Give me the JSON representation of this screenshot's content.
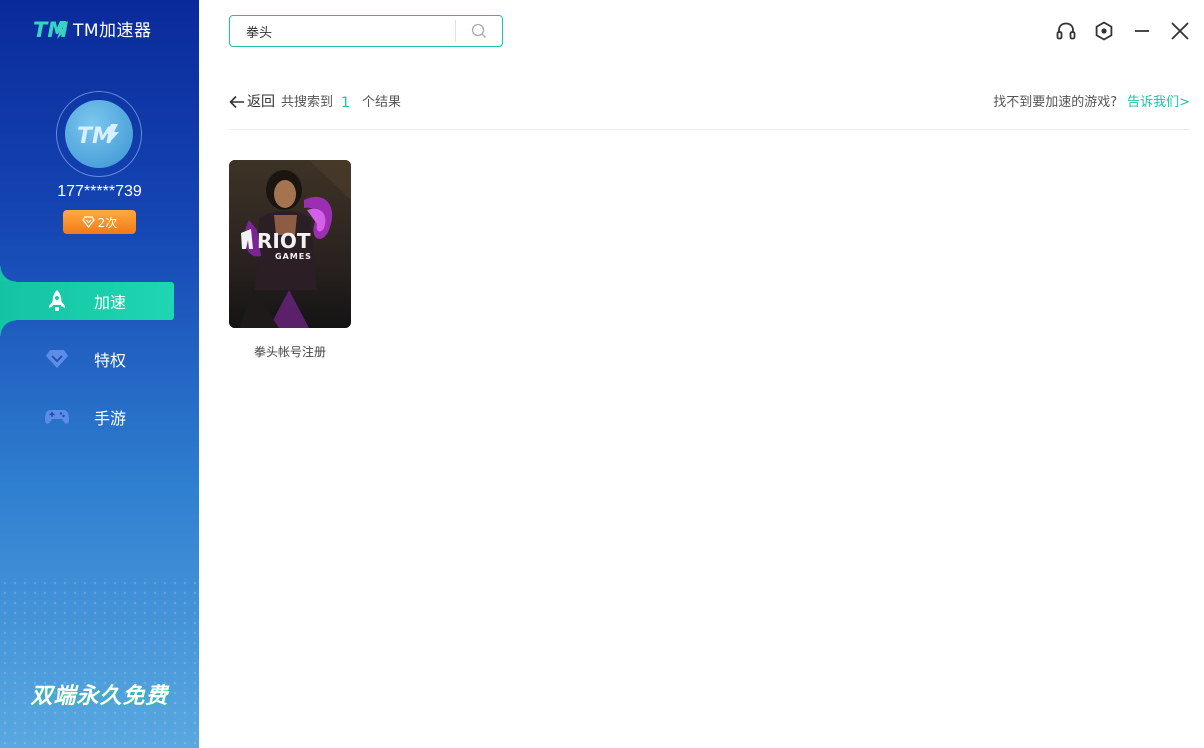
{
  "app": {
    "title": "TM加速器"
  },
  "user": {
    "phone": "177*****739",
    "vip_count": "2次"
  },
  "nav": {
    "items": [
      {
        "label": "加速",
        "icon": "rocket-icon",
        "active": true
      },
      {
        "label": "特权",
        "icon": "diamond-icon",
        "active": false
      },
      {
        "label": "手游",
        "icon": "gamepad-icon",
        "active": false
      }
    ]
  },
  "slogan": "双端永久免费",
  "search": {
    "value": "拳头",
    "placeholder": ""
  },
  "results": {
    "back_label": "返回",
    "prefix": "共搜索到",
    "count": "1",
    "suffix": "个结果",
    "feedback_text": "找不到要加速的游戏?",
    "feedback_link": "告诉我们>"
  },
  "games": [
    {
      "name": "拳头帐号注册",
      "cover_text_top": "RIOT",
      "cover_text_bottom": "GAMES"
    }
  ],
  "colors": {
    "accent": "#1fc1a5",
    "sidebar_top": "#0a2a9a",
    "sidebar_bottom": "#5aa8e0",
    "badge": "#f27a18"
  }
}
